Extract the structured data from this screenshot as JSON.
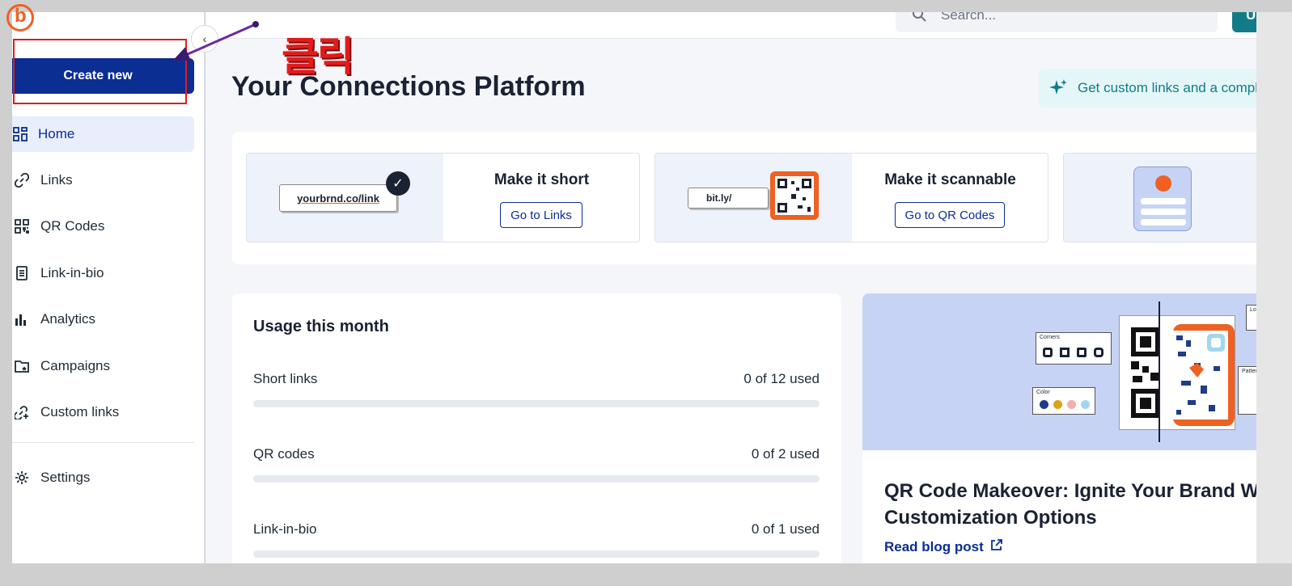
{
  "sidebar": {
    "create_label": "Create new",
    "collapse_glyph": "‹",
    "items": [
      {
        "label": "Home",
        "icon": "home-grid-icon",
        "active": true
      },
      {
        "label": "Links",
        "icon": "link-icon"
      },
      {
        "label": "QR Codes",
        "icon": "qr-code-icon"
      },
      {
        "label": "Link-in-bio",
        "icon": "link-in-bio-icon"
      },
      {
        "label": "Analytics",
        "icon": "analytics-bar-icon"
      },
      {
        "label": "Campaigns",
        "icon": "campaigns-folder-icon"
      },
      {
        "label": "Custom links",
        "icon": "custom-links-icon"
      }
    ],
    "settings_label": "Settings"
  },
  "topbar": {
    "search_placeholder": "Search...",
    "upgrade_label": "Upg"
  },
  "annotation": {
    "label": "클릭",
    "color": "#e31b1b"
  },
  "main": {
    "title": "Your Connections Platform",
    "promo_text": "Get custom links and a compli",
    "features": [
      {
        "title": "Make it short",
        "button": "Go to Links",
        "art_text": "yourbrnd.co/link"
      },
      {
        "title": "Make it scannable",
        "button": "Go to QR Codes",
        "art_text": "bit.ly/"
      },
      {
        "title": "",
        "button": ""
      }
    ],
    "usage": {
      "title": "Usage this month",
      "rows": [
        {
          "label": "Short links",
          "count": "0 of 12 used",
          "fraction": 0
        },
        {
          "label": "QR codes",
          "count": "0 of 2 used",
          "fraction": 0
        },
        {
          "label": "Link-in-bio",
          "count": "0 of 1 used",
          "fraction": 0
        }
      ]
    },
    "blog": {
      "title_line1": "QR Code Makeover: Ignite Your Brand W",
      "title_line2": "Customization Options",
      "link": "Read blog post",
      "art_labels": {
        "corners": "Corners",
        "color": "Color",
        "logo": "Logo",
        "pattern": "Pattern"
      }
    }
  },
  "colors": {
    "brand": "#0b2e92",
    "accent_orange": "#ee6123",
    "teal": "#127b88",
    "active_bg": "#e8eefc"
  }
}
